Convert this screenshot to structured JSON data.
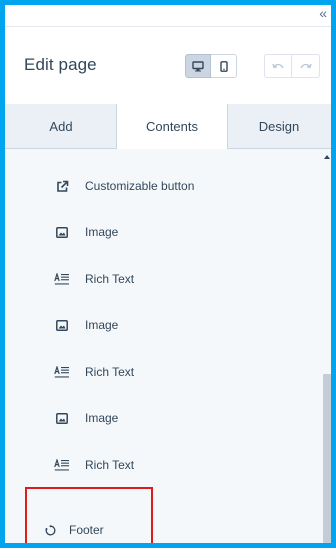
{
  "topbar": {
    "collapse_icon": "double-chevron-left-icon",
    "collapse_glyph": "«"
  },
  "header": {
    "title": "Edit page"
  },
  "viewport": {
    "desktop_icon": "desktop-icon",
    "mobile_icon": "mobile-icon"
  },
  "history": {
    "undo_icon": "undo-icon",
    "redo_icon": "redo-icon"
  },
  "tabs": [
    {
      "label": "Add"
    },
    {
      "label": "Contents"
    },
    {
      "label": "Design"
    }
  ],
  "items": [
    {
      "label": "Customizable button",
      "icon": "external-link-icon"
    },
    {
      "label": "Image",
      "icon": "image-icon"
    },
    {
      "label": "Rich Text",
      "icon": "rich-text-icon"
    },
    {
      "label": "Image",
      "icon": "image-icon"
    },
    {
      "label": "Rich Text",
      "icon": "rich-text-icon"
    },
    {
      "label": "Image",
      "icon": "image-icon"
    },
    {
      "label": "Rich Text",
      "icon": "rich-text-icon"
    }
  ],
  "footer": {
    "label": "Footer",
    "icon": "footer-module-icon"
  },
  "colors": {
    "frame": "#00a4ef",
    "text": "#33475b",
    "highlight": "#e11a1a"
  }
}
